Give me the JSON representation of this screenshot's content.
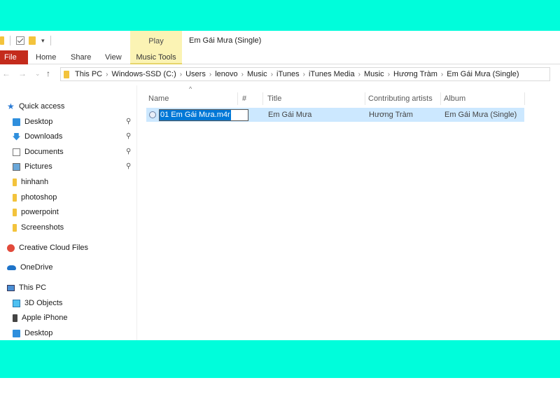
{
  "window": {
    "title": "Em Gái Mưa (Single)",
    "context_tab": "Play"
  },
  "ribbon": {
    "tabs": [
      "File",
      "Home",
      "Share",
      "View",
      "Music Tools"
    ]
  },
  "address": {
    "crumbs": [
      "This PC",
      "Windows-SSD (C:)",
      "Users",
      "lenovo",
      "Music",
      "iTunes",
      "iTunes Media",
      "Music",
      "Hương Tràm",
      "Em Gái Mưa (Single)"
    ]
  },
  "nav": {
    "quick_access": "Quick access",
    "pinned": [
      "Desktop",
      "Downloads",
      "Documents",
      "Pictures"
    ],
    "folders": [
      "hinhanh",
      "photoshop",
      "powerpoint",
      "Screenshots"
    ],
    "creative_cloud": "Creative Cloud Files",
    "onedrive": "OneDrive",
    "this_pc": "This PC",
    "pc_items": [
      "3D Objects",
      "Apple iPhone",
      "Desktop"
    ]
  },
  "columns": {
    "name": "Name",
    "number": "#",
    "title": "Title",
    "artists": "Contributing artists",
    "album": "Album"
  },
  "file_row": {
    "name_editing": "01 Em Gái Mưa.m4r",
    "title": "Em Gái Mưa",
    "artists": "Hương Tràm",
    "album": "Em Gái Mưa (Single)"
  },
  "colors": {
    "band": "#00fddb",
    "file_tab": "#c42b1c",
    "context_tab": "#fbf3b4",
    "selection": "#cce8ff"
  }
}
